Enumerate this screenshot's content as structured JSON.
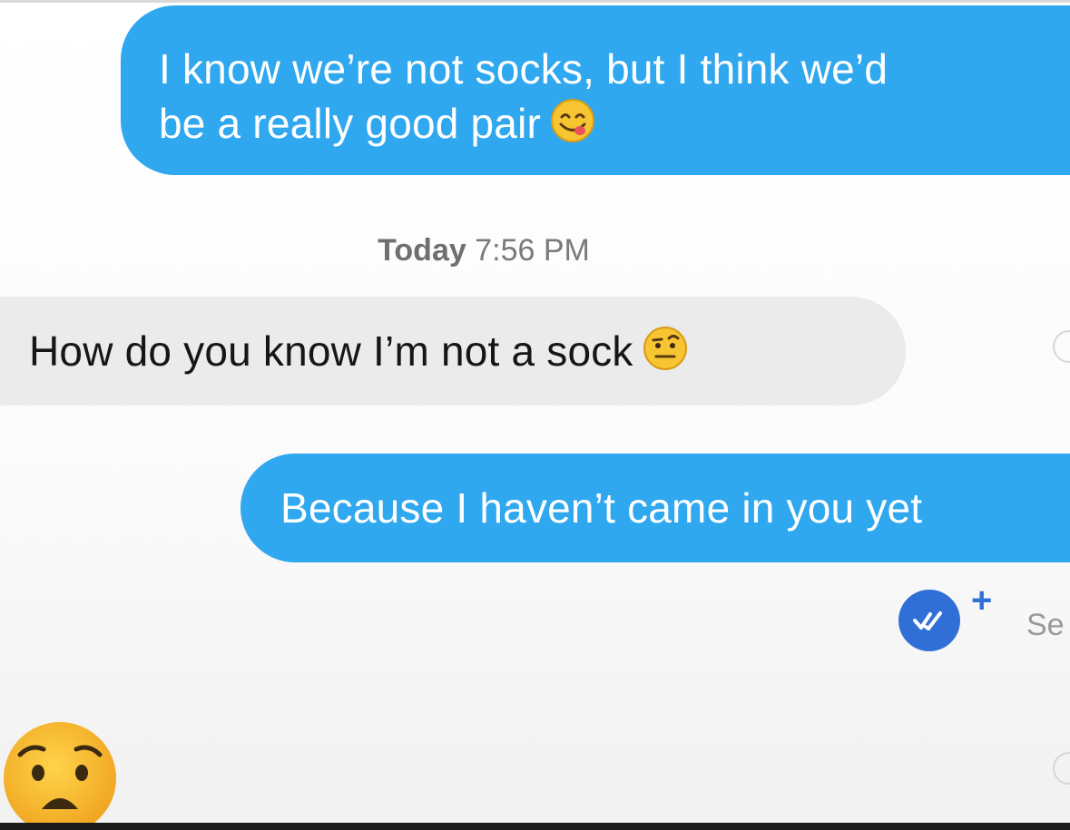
{
  "messages": [
    {
      "direction": "sent",
      "lines": [
        "I know we’re not socks, but I think we’d",
        "be a really good pair"
      ],
      "emoji": "smiling-face-with-tongue-icon"
    },
    {
      "direction": "received",
      "text": "How do you know I’m not a sock",
      "emoji": "face-with-raised-eyebrow-icon"
    },
    {
      "direction": "sent",
      "text": "Because I haven’t came in you yet"
    }
  ],
  "timestamp": {
    "day": "Today",
    "time": "7:56 PM"
  },
  "read_receipt": {
    "plus": "+",
    "status": "Se"
  },
  "reaction_emoji": "anguished-face-icon",
  "colors": {
    "sent_bubble": "#2fa8ef",
    "received_bubble": "#ebebeb",
    "read_badge": "#2f6fd6",
    "timestamp_text": "#7a7a7a"
  }
}
